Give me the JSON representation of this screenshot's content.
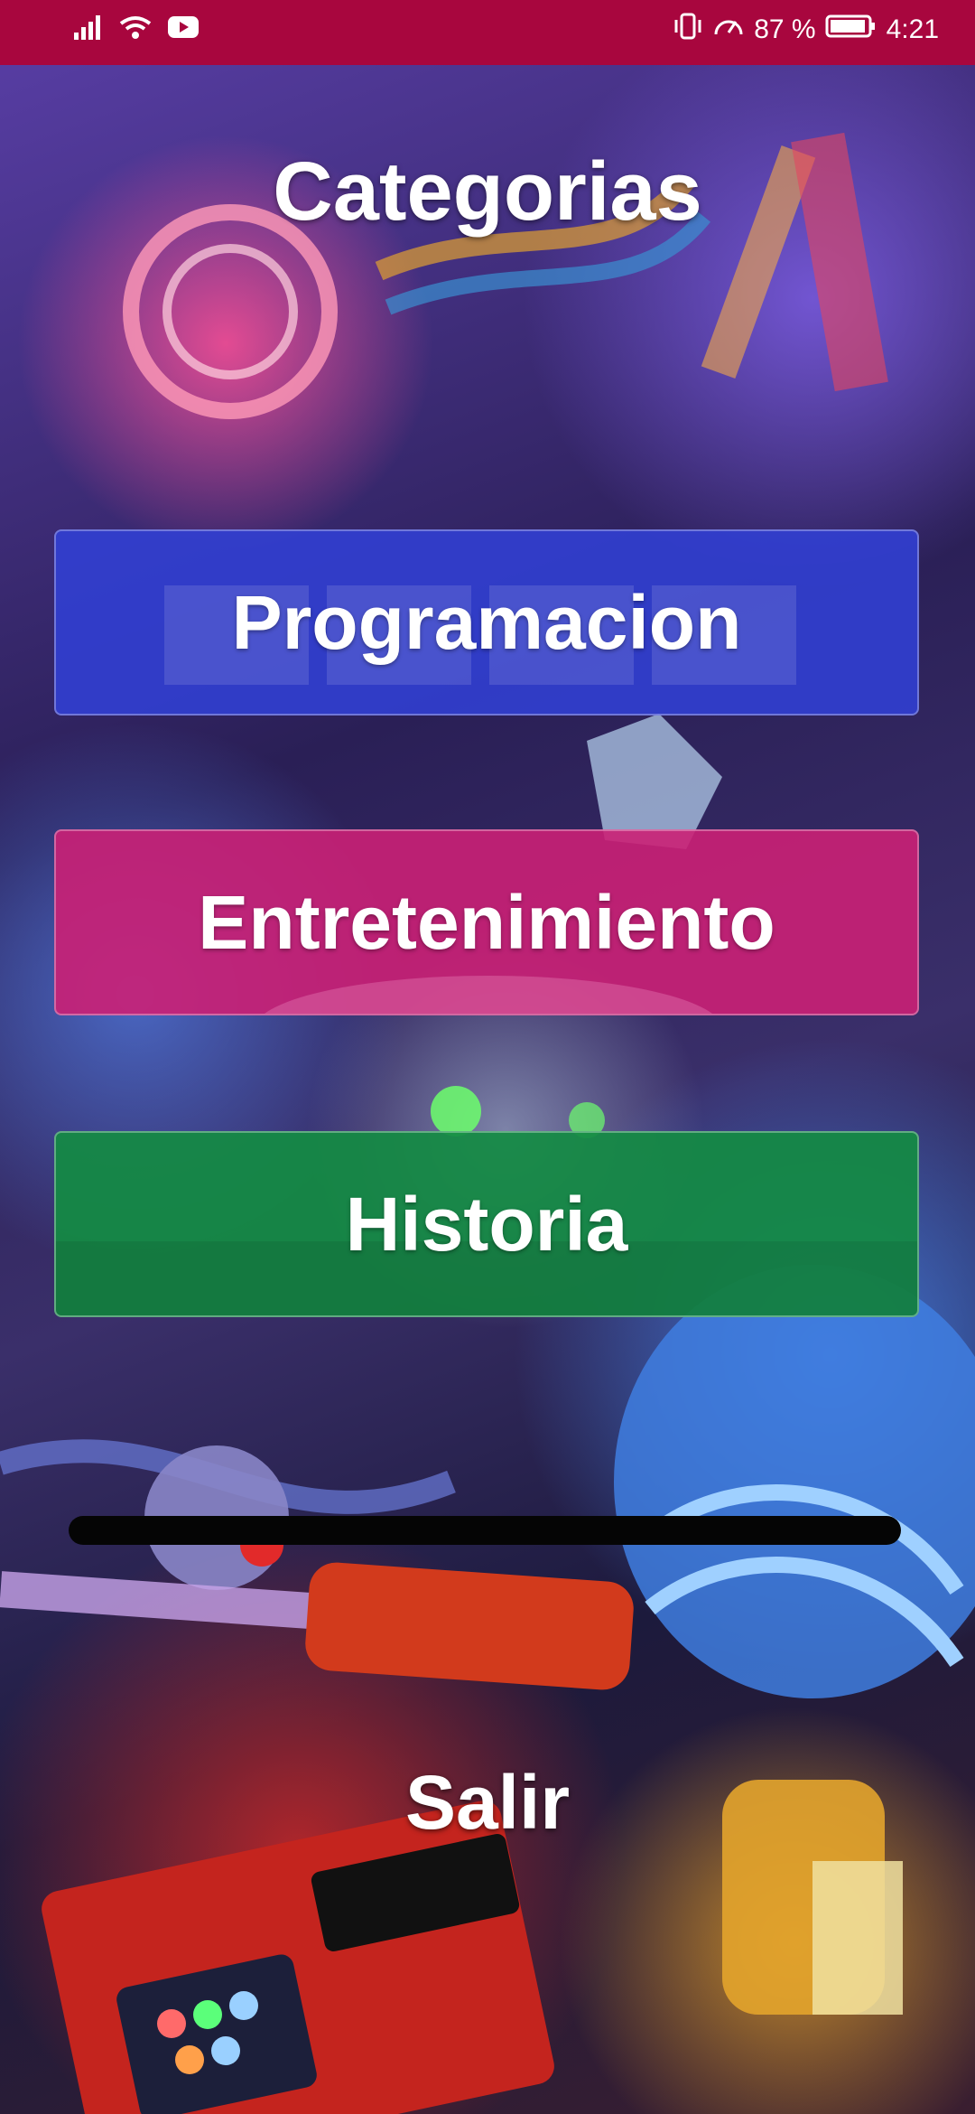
{
  "status_bar": {
    "battery_percent": "87 %",
    "time": "4:21",
    "icons": [
      "signal-icon",
      "wifi-icon",
      "youtube-icon",
      "vibrate-icon",
      "speed-icon",
      "battery-icon"
    ]
  },
  "screen": {
    "title": "Categorias",
    "categories": [
      {
        "label": "Programacion",
        "color": "#2332d2"
      },
      {
        "label": "Entretenimiento",
        "color": "#c8146e"
      },
      {
        "label": "Historia",
        "color": "#0a873c"
      }
    ],
    "progress": 1.0,
    "exit_label": "Salir"
  },
  "colors": {
    "status_bar": "#a8063e",
    "text": "#ffffff"
  }
}
